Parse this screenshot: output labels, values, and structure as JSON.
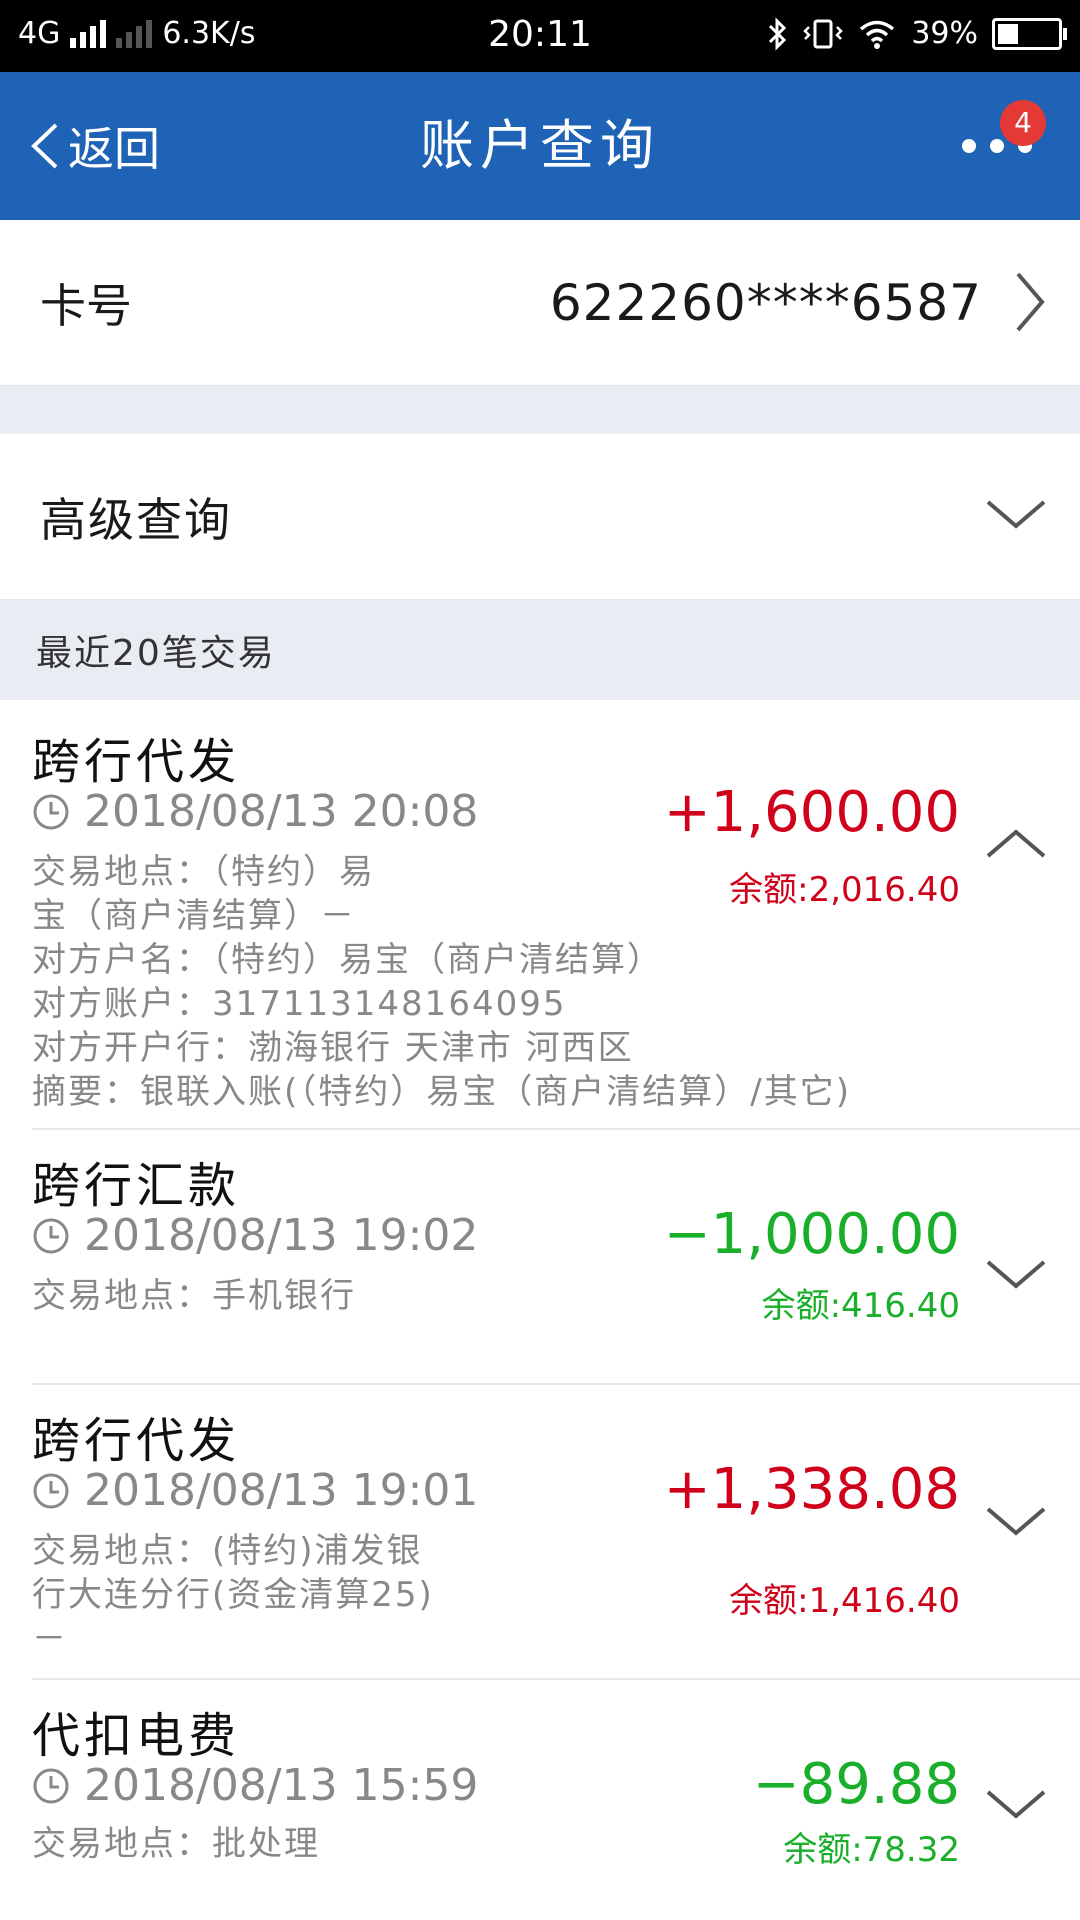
{
  "status_bar": {
    "network": "4G",
    "speed": "6.3K/s",
    "time": "20:11",
    "battery": "39%",
    "battery_level": 0.39
  },
  "header": {
    "back_label": "返回",
    "title": "账户查询",
    "badge_count": "4"
  },
  "card": {
    "label": "卡号",
    "number": "622260****6587"
  },
  "advanced": {
    "label": "高级查询"
  },
  "recent_label": "最近20笔交易",
  "colors": {
    "header_bg": "#1e63b6",
    "income": "#d0021b",
    "expense": "#1aaf2a",
    "section_bg": "#e9edf3"
  },
  "transactions": [
    {
      "title": "跨行代发",
      "time": "2018/08/13 20:08",
      "amount": "+1,600.00",
      "balance": "余额:2,016.40",
      "location_line1": "交易地点：（特约）易",
      "location_line2": "宝（商户清结算）－",
      "counterparty_name": "对方户名：（特约）易宝（商户清结算）",
      "counterparty_account": "对方账户：317113148164095",
      "counterparty_bank": "对方开户行：渤海银行 天津市 河西区",
      "summary": "摘要：银联入账(（特约）易宝（商户清结算）/其它)",
      "expanded": true
    },
    {
      "title": "跨行汇款",
      "time": "2018/08/13 19:02",
      "amount": "−1,000.00",
      "balance": "余额:416.40",
      "location_line1": "交易地点：手机银行",
      "expanded": false
    },
    {
      "title": "跨行代发",
      "time": "2018/08/13 19:01",
      "amount": "+1,338.08",
      "balance": "余额:1,416.40",
      "location_line1": "交易地点：(特约)浦发银",
      "location_line2": "行大连分行(资金清算25)",
      "location_line3": "－",
      "expanded": false
    },
    {
      "title": "代扣电费",
      "time": "2018/08/13 15:59",
      "amount": "−89.88",
      "balance": "余额:78.32",
      "location_line1": "交易地点：批处理",
      "expanded": false
    }
  ]
}
